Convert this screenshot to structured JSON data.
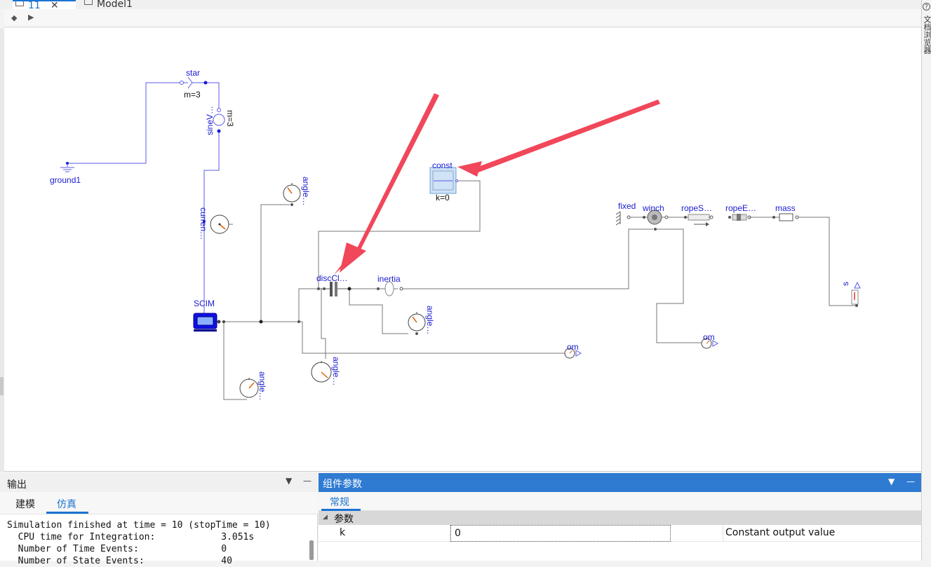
{
  "tabs": [
    {
      "label": "11"
    },
    {
      "label": "Model1"
    }
  ],
  "right_panel_label": "文档浏览器",
  "diagram": {
    "labels": {
      "star": "star",
      "star_m": "m=3",
      "sine": "sineV…",
      "sine_m": "m=3",
      "ground": "ground1",
      "current": "curren…",
      "scim": "SCIM",
      "const": "const",
      "const_k": "k=0",
      "disc": "discCl…",
      "inertia": "inertia",
      "angle1": "angle…",
      "angle2": "angle…",
      "angle3": "angle…",
      "angle4": "angle…",
      "om1": "om",
      "om2": "om",
      "fixed": "fixed",
      "winch": "winch",
      "ropeS": "ropeS…",
      "ropeE": "ropeE…",
      "mass": "mass",
      "s": "s"
    },
    "colors": {
      "wire_blue": "#5050e8",
      "wire_gray": "#707070",
      "label_blue": "#1a1ad0",
      "annotation_arrow": "#f0475a",
      "selection": "#cfe2f6"
    }
  },
  "output": {
    "title": "输出",
    "tabs": [
      "建模",
      "仿真"
    ],
    "active_tab": "仿真",
    "log": [
      "Simulation finished at time = 10 (stopTime = 10)",
      "  CPU time for Integration:            3.051s",
      "  Number of Time Events:               0",
      "  Number of State Events:              40"
    ]
  },
  "params": {
    "title": "组件参数",
    "tab": "常规",
    "group": "参数",
    "rows": [
      {
        "name": "k",
        "value": "0",
        "description": "Constant output value"
      }
    ]
  },
  "icons": {
    "dropdown": "▼",
    "minimize": "—",
    "close": "✕",
    "layers": "layers-icon",
    "arrow": "▶"
  }
}
